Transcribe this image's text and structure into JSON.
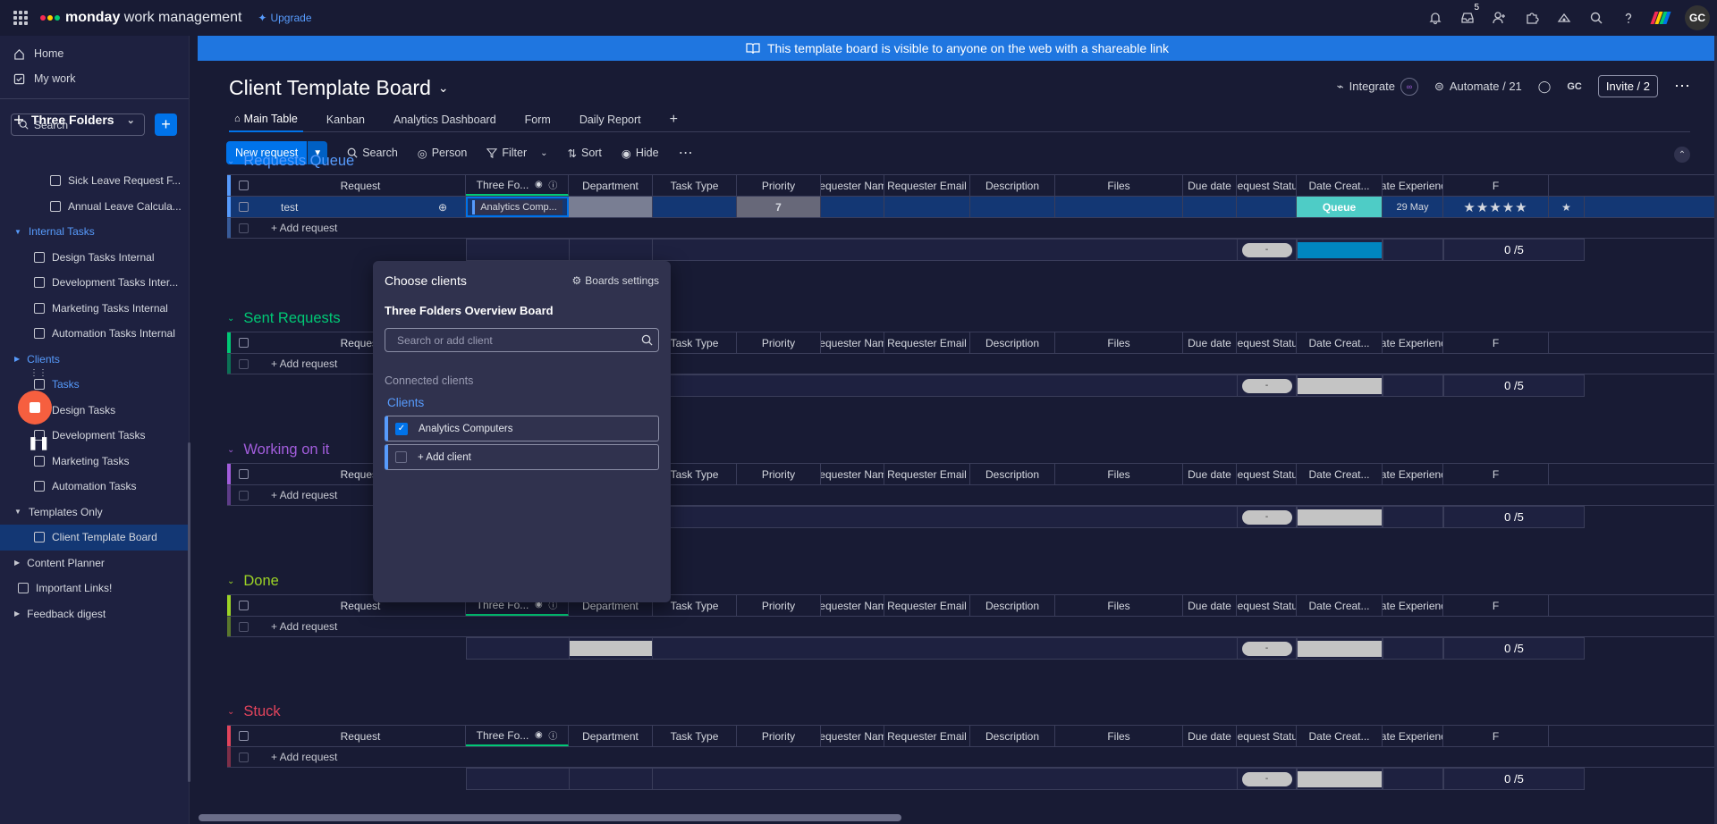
{
  "topbar": {
    "brand_bold": "monday",
    "brand_rest": " work management",
    "upgrade": "Upgrade",
    "inbox_count": "5",
    "avatar": "GC"
  },
  "banner": {
    "text": "This template board is visible to anyone on the web with a shareable link"
  },
  "sidebar": {
    "home": "Home",
    "my_work": "My work",
    "workspace": "Three Folders",
    "search": "Search",
    "tree": [
      {
        "type": "item",
        "label": "Sick Leave Request F...",
        "indent": 1
      },
      {
        "type": "item",
        "label": "Annual Leave Calcula...",
        "indent": 1
      },
      {
        "type": "folder",
        "label": "Internal Tasks",
        "blue": true
      },
      {
        "type": "item",
        "label": "Design Tasks Internal",
        "indent": 0
      },
      {
        "type": "item",
        "label": "Development Tasks Inter...",
        "indent": 0
      },
      {
        "type": "item",
        "label": "Marketing Tasks Internal",
        "indent": 0
      },
      {
        "type": "item",
        "label": "Automation Tasks Internal",
        "indent": 0
      },
      {
        "type": "folder",
        "label": "Clients",
        "blue": true,
        "collapsed": true
      },
      {
        "type": "item",
        "label": "Tasks",
        "indent": 0,
        "blue": true
      },
      {
        "type": "item",
        "label": "Design Tasks",
        "indent": 0
      },
      {
        "type": "item",
        "label": "Development Tasks",
        "indent": 0
      },
      {
        "type": "item",
        "label": "Marketing Tasks",
        "indent": 0
      },
      {
        "type": "item",
        "label": "Automation Tasks",
        "indent": 0
      },
      {
        "type": "folder",
        "label": "Templates Only"
      },
      {
        "type": "item",
        "label": "Client Template Board",
        "indent": 0,
        "selected": true
      },
      {
        "type": "folder",
        "label": "Content Planner",
        "collapsed": true
      },
      {
        "type": "root",
        "label": "Important Links!"
      },
      {
        "type": "folder",
        "label": "Feedback digest",
        "collapsed": true
      }
    ]
  },
  "board": {
    "title": "Client Template Board",
    "integrate": "Integrate",
    "automate": "Automate / 21",
    "user_initials": "GC",
    "invite": "Invite / 2",
    "tabs": [
      "Main Table",
      "Kanban",
      "Analytics Dashboard",
      "Form",
      "Daily Report"
    ],
    "toolbar": {
      "new_item": "New request",
      "search": "Search",
      "person": "Person",
      "filter": "Filter",
      "sort": "Sort",
      "hide": "Hide"
    }
  },
  "columns": [
    "Request",
    "Three Fo...",
    "Department",
    "Task Type",
    "Priority",
    "Requester Name",
    "Requester Email",
    "Description",
    "Files",
    "Due date",
    "Request Status",
    "Date Creat...",
    "Rate Experience",
    "F"
  ],
  "add_item": "+ Add request",
  "rating_summary": "0 /5",
  "groups": [
    {
      "name": "Requests Queue",
      "color": "#579bfc",
      "row": {
        "name": "test",
        "connected": "Analytics Comp...",
        "priority": "7",
        "status": "Queue",
        "status_color": "#4eccc6",
        "date": "29 May",
        "stars": "★★★★★"
      },
      "summary_status_color": "#0086c0"
    },
    {
      "name": "Sent Requests",
      "color": "#00c875",
      "summary_status_color": "#c4c4c4"
    },
    {
      "name": "Working on it",
      "color": "#a25ddc",
      "summary_status_color": "#c4c4c4"
    },
    {
      "name": "Done",
      "color": "#9cd326",
      "summary_status_color": "#c4c4c4"
    },
    {
      "name": "Stuck",
      "color": "#e2445c",
      "summary_status_color": "#c4c4c4"
    }
  ],
  "popup": {
    "title": "Choose clients",
    "settings": "Boards settings",
    "board_name": "Three Folders Overview Board",
    "search_placeholder": "Search or add client",
    "connected_label": "Connected clients",
    "link": "Clients",
    "items": [
      "Analytics Computers"
    ],
    "add": "+ Add client"
  }
}
